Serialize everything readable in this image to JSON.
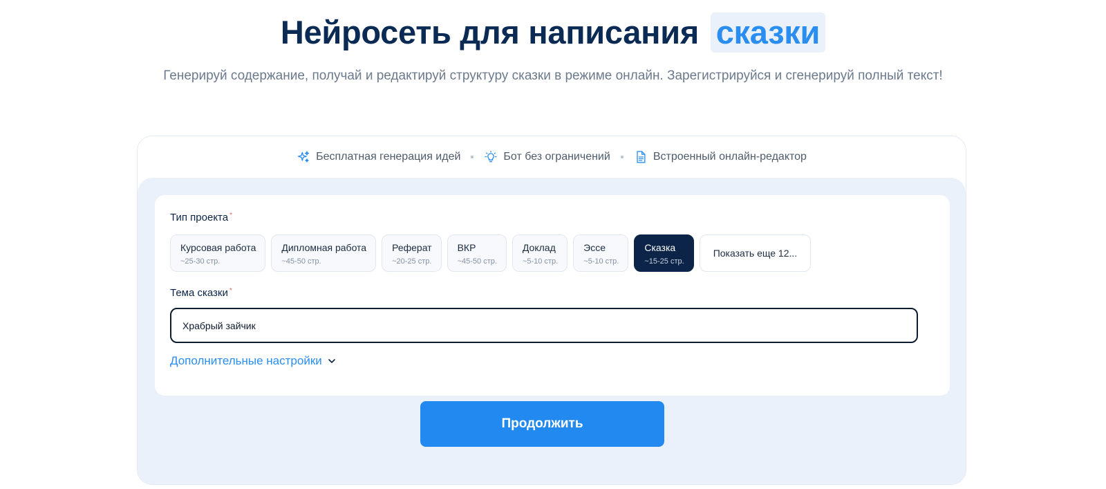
{
  "hero": {
    "title_main": "Нейросеть для написания",
    "title_highlight": "сказки",
    "subtitle": "Генерируй содержание, получай и редактируй структуру сказки в режиме онлайн. Зарегистрируйся и сгенерируй полный текст!"
  },
  "features": [
    {
      "icon": "sparkles-icon",
      "label": "Бесплатная генерация идей"
    },
    {
      "icon": "lightbulb-icon",
      "label": "Бот без ограничений"
    },
    {
      "icon": "document-icon",
      "label": "Встроенный онлайн-редактор"
    }
  ],
  "form": {
    "project_type_label": "Тип проекта",
    "required_mark": "*",
    "project_types": [
      {
        "name": "Курсовая работа",
        "pages": "~25-30 стр.",
        "active": false
      },
      {
        "name": "Дипломная работа",
        "pages": "~45-50 стр.",
        "active": false
      },
      {
        "name": "Реферат",
        "pages": "~20-25 стр.",
        "active": false
      },
      {
        "name": "ВКР",
        "pages": "~45-50 стр.",
        "active": false
      },
      {
        "name": "Доклад",
        "pages": "~5-10 стр.",
        "active": false
      },
      {
        "name": "Эссе",
        "pages": "~5-10 стр.",
        "active": false
      },
      {
        "name": "Сказка",
        "pages": "~15-25 стр.",
        "active": true
      }
    ],
    "show_more_label": "Показать еще 12...",
    "topic_label": "Тема сказки",
    "topic_value": "Храбрый зайчик",
    "advanced_settings_label": "Дополнительные настройки",
    "continue_label": "Продолжить"
  },
  "colors": {
    "accent": "#2289f0",
    "dark": "#0b2447",
    "highlight_bg": "#eaf1fb",
    "panel_bg": "#ebf1fa"
  }
}
